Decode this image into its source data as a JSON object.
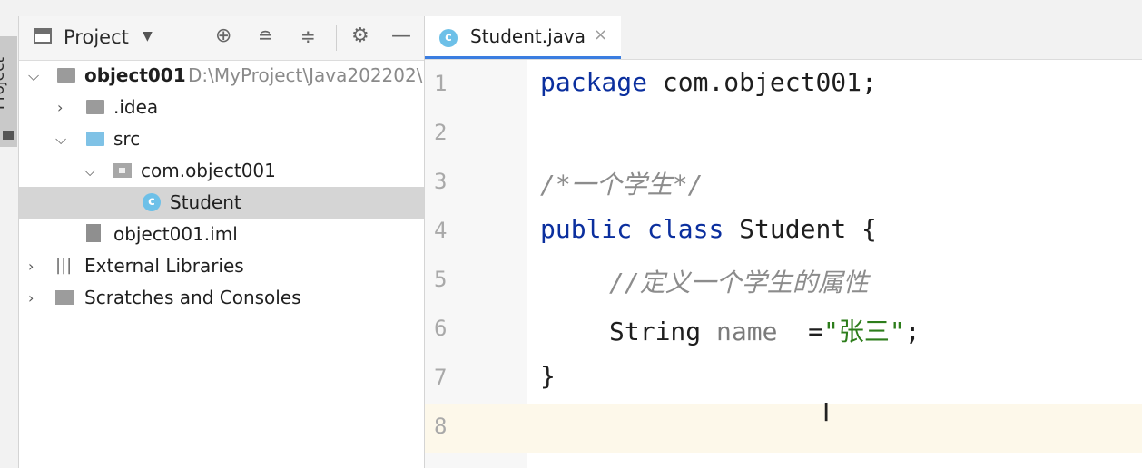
{
  "sidebar_tab": {
    "label": "Project"
  },
  "project_panel": {
    "title": "Project",
    "tree": [
      {
        "label": "object001",
        "path": "D:\\MyProject\\Java202202\\",
        "bold": true
      },
      {
        "label": ".idea"
      },
      {
        "label": "src"
      },
      {
        "label": "com.object001"
      },
      {
        "label": "Student"
      },
      {
        "label": "object001.iml"
      },
      {
        "label": "External Libraries"
      },
      {
        "label": "Scratches and Consoles"
      }
    ]
  },
  "editor": {
    "tab": {
      "label": "Student.java",
      "close": "×"
    },
    "line_numbers": [
      "1",
      "2",
      "3",
      "4",
      "5",
      "6",
      "7",
      "8"
    ],
    "code": {
      "l1_kw": "package",
      "l1_rest": " com.object001;",
      "l3_comment": "/*一个学生*/",
      "l4_kw1": "public",
      "l4_kw2": "class",
      "l4_rest": " Student {",
      "l5_comment": "//定义一个学生的属性",
      "l6_type": "String",
      "l6_field": " name",
      "l6_eq": "  =",
      "l6_str": "\"张三\"",
      "l6_end": ";",
      "l7": "}"
    }
  },
  "colors": {
    "keyword": "#0b2f9e",
    "comment": "#8c8c8c",
    "string": "#2d7d1b",
    "selection": "#d5d5d5",
    "current_line": "#fdf8ea",
    "tab_underline": "#3b7de0"
  }
}
